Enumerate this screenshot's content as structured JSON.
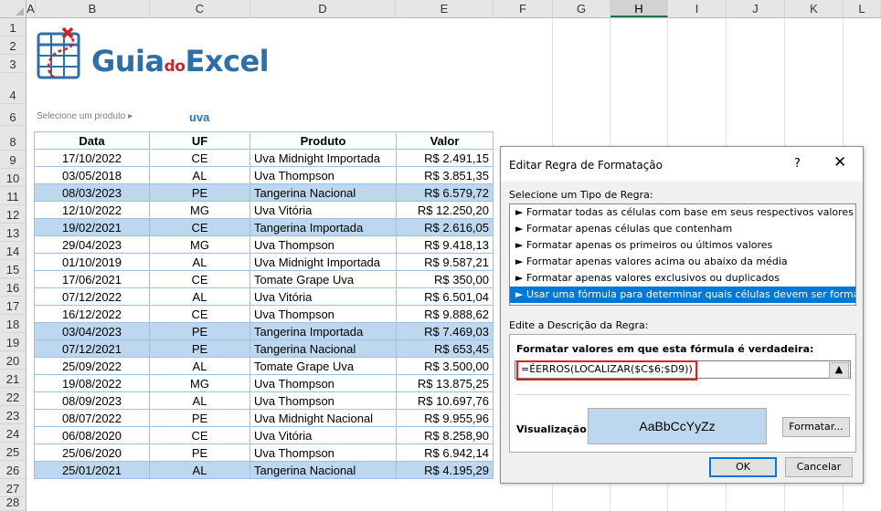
{
  "sheet": {
    "columns": [
      "A",
      "B",
      "C",
      "D",
      "E",
      "F",
      "G",
      "H",
      "I",
      "J",
      "K",
      "L"
    ],
    "selected_column": "H",
    "rows": [
      "1",
      "2",
      "3",
      "4",
      "6",
      "8",
      "9",
      "10",
      "11",
      "12",
      "13",
      "14",
      "15",
      "16",
      "17",
      "18",
      "19",
      "20",
      "21",
      "22",
      "23",
      "24",
      "25",
      "26",
      "27",
      "28"
    ]
  },
  "logo": {
    "part1": "Guia",
    "part2": "do",
    "part3": "Excel"
  },
  "selector": {
    "label": "Selecione um produto ▸",
    "value": "uva"
  },
  "table": {
    "headers": [
      "Data",
      "UF",
      "Produto",
      "Valor"
    ],
    "rows": [
      {
        "data": "17/10/2022",
        "uf": "CE",
        "produto": "Uva Midnight Importada",
        "valor": "R$ 2.491,15"
      },
      {
        "data": "03/05/2018",
        "uf": "AL",
        "produto": "Uva Thompson",
        "valor": "R$ 3.851,35"
      },
      {
        "data": "08/03/2023",
        "uf": "PE",
        "produto": "Tangerina Nacional",
        "valor": "R$ 6.579,72"
      },
      {
        "data": "12/10/2022",
        "uf": "MG",
        "produto": "Uva Vitória",
        "valor": "R$ 12.250,20"
      },
      {
        "data": "19/02/2021",
        "uf": "CE",
        "produto": "Tangerina Importada",
        "valor": "R$ 2.616,05"
      },
      {
        "data": "29/04/2023",
        "uf": "MG",
        "produto": "Uva Thompson",
        "valor": "R$ 9.418,13"
      },
      {
        "data": "01/10/2019",
        "uf": "AL",
        "produto": "Uva Midnight Importada",
        "valor": "R$ 9.587,21"
      },
      {
        "data": "17/06/2021",
        "uf": "CE",
        "produto": "Tomate Grape Uva",
        "valor": "R$ 350,00"
      },
      {
        "data": "07/12/2022",
        "uf": "AL",
        "produto": "Uva Vitória",
        "valor": "R$ 6.501,04"
      },
      {
        "data": "16/12/2022",
        "uf": "CE",
        "produto": "Uva Thompson",
        "valor": "R$ 9.888,62"
      },
      {
        "data": "03/04/2023",
        "uf": "PE",
        "produto": "Tangerina Importada",
        "valor": "R$ 7.469,03"
      },
      {
        "data": "07/12/2021",
        "uf": "PE",
        "produto": "Tangerina Nacional",
        "valor": "R$ 653,45"
      },
      {
        "data": "25/09/2022",
        "uf": "AL",
        "produto": "Tomate Grape Uva",
        "valor": "R$ 3.500,00"
      },
      {
        "data": "19/08/2022",
        "uf": "MG",
        "produto": "Uva Thompson",
        "valor": "R$ 13.875,25"
      },
      {
        "data": "08/09/2023",
        "uf": "AL",
        "produto": "Uva Thompson",
        "valor": "R$ 10.697,76"
      },
      {
        "data": "08/07/2022",
        "uf": "PE",
        "produto": "Uva Midnight Nacional",
        "valor": "R$ 9.955,96"
      },
      {
        "data": "06/08/2020",
        "uf": "CE",
        "produto": "Uva Vitória",
        "valor": "R$ 8.258,90"
      },
      {
        "data": "25/06/2020",
        "uf": "PE",
        "produto": "Uva Thompson",
        "valor": "R$ 6.942,14"
      },
      {
        "data": "25/01/2021",
        "uf": "AL",
        "produto": "Tangerina Nacional",
        "valor": "R$ 4.195,29"
      }
    ]
  },
  "dialog": {
    "title": "Editar Regra de Formatação",
    "help": "?",
    "close": "✕",
    "rule_type_label": "Selecione um Tipo de Regra:",
    "rule_types": [
      "► Formatar todas as células com base em seus respectivos valores",
      "► Formatar apenas células que contenham",
      "► Formatar apenas os primeiros ou últimos valores",
      "► Formatar apenas valores acima ou abaixo da média",
      "► Formatar apenas valores exclusivos ou duplicados",
      "► Usar uma fórmula para determinar quais células devem ser formatadas"
    ],
    "selected_rule_index": 5,
    "description_label": "Edite a Descrição da Regra:",
    "formula_caption": "Formatar valores em que esta fórmula é verdadeira:",
    "formula_value": "=ÉERROS(LOCALIZAR($C$6;$D9))",
    "preview_label": "Visualização:",
    "preview_text": "AaBbCcYyZz",
    "format_button": "Formatar...",
    "ok_button": "OK",
    "cancel_button": "Cancelar"
  },
  "colors": {
    "highlight": "#bdd7ee",
    "accent": "#0078d7",
    "excel_green": "#217346",
    "formula_border": "#e02020"
  }
}
